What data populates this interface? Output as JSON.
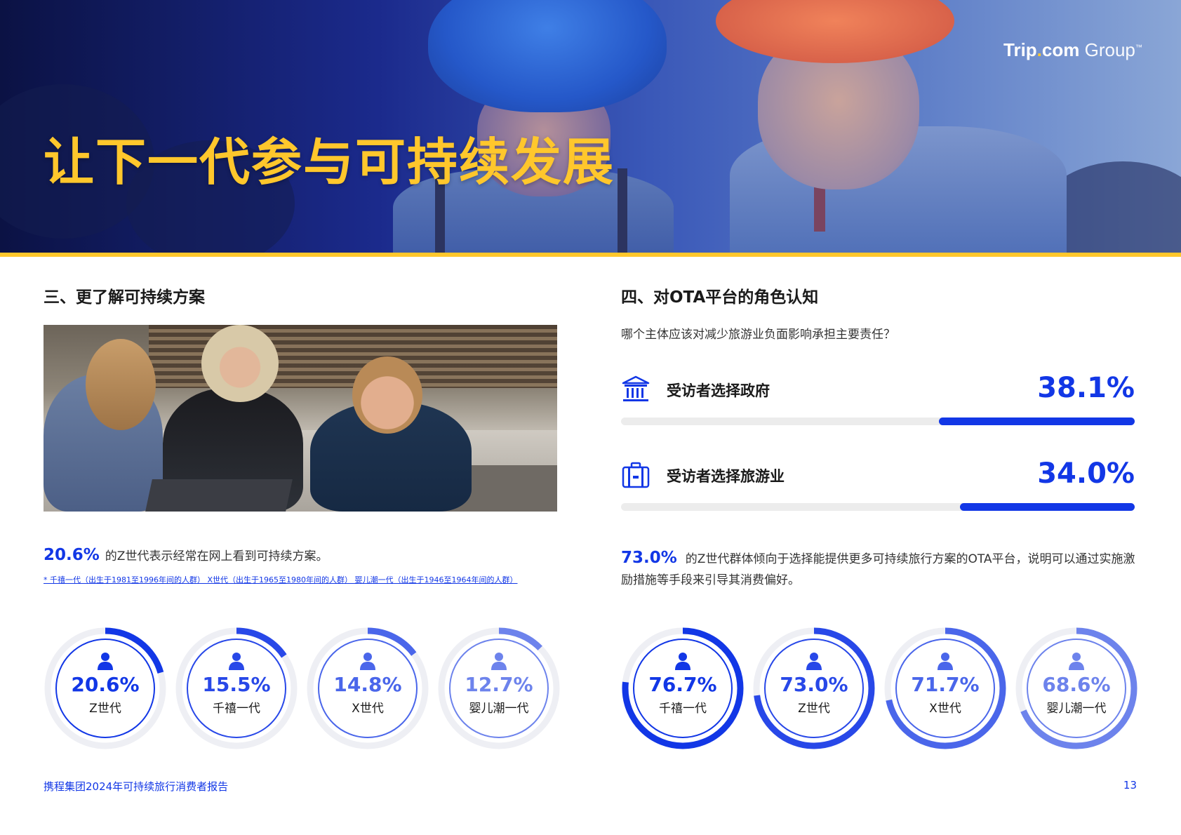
{
  "hero": {
    "title": "让下一代参与可持续发展",
    "logo": {
      "trip": "Trip",
      "dot": ".",
      "com": "com",
      "group": " Group",
      "mark": "™"
    }
  },
  "left": {
    "section_title": "三、更了解可持续方案",
    "stat_value": "20.6%",
    "stat_text": "的Z世代表示经常在网上看到可持续方案。",
    "footnote": "* 千禧一代（出生于1981至1996年间的人群） X世代（出生于1965至1980年间的人群） 婴儿潮一代（出生于1946至1964年间的人群）",
    "donuts": [
      {
        "value": 20.6,
        "pct": "20.6%",
        "label": "Z世代",
        "color": "#1237e6"
      },
      {
        "value": 15.5,
        "pct": "15.5%",
        "label": "千禧一代",
        "color": "#2848e8"
      },
      {
        "value": 14.8,
        "pct": "14.8%",
        "label": "X世代",
        "color": "#4a66ea"
      },
      {
        "value": 12.7,
        "pct": "12.7%",
        "label": "婴儿潮一代",
        "color": "#6d83ec"
      }
    ]
  },
  "right": {
    "section_title": "四、对OTA平台的角色认知",
    "question": "哪个主体应该对减少旅游业负面影响承担主要责任？",
    "responses": [
      {
        "icon": "government-building-icon",
        "label": "受访者选择政府",
        "value": 38.1,
        "display": "38.1%"
      },
      {
        "icon": "suitcase-icon",
        "label": "受访者选择旅游业",
        "value": 34.0,
        "display": "34.0%"
      }
    ],
    "para_value": "73.0%",
    "para_text": "的Z世代群体倾向于选择能提供更多可持续旅行方案的OTA平台，说明可以通过实施激励措施等手段来引导其消费偏好。",
    "donuts": [
      {
        "value": 76.7,
        "pct": "76.7%",
        "label": "千禧一代",
        "color": "#1237e6"
      },
      {
        "value": 73.0,
        "pct": "73.0%",
        "label": "Z世代",
        "color": "#2848e8"
      },
      {
        "value": 71.7,
        "pct": "71.7%",
        "label": "X世代",
        "color": "#4a66ea"
      },
      {
        "value": 68.6,
        "pct": "68.6%",
        "label": "婴儿潮一代",
        "color": "#6d83ec"
      }
    ]
  },
  "footer": {
    "report_title": "携程集团2024年可持续旅行消费者报告",
    "page_number": "13"
  }
}
